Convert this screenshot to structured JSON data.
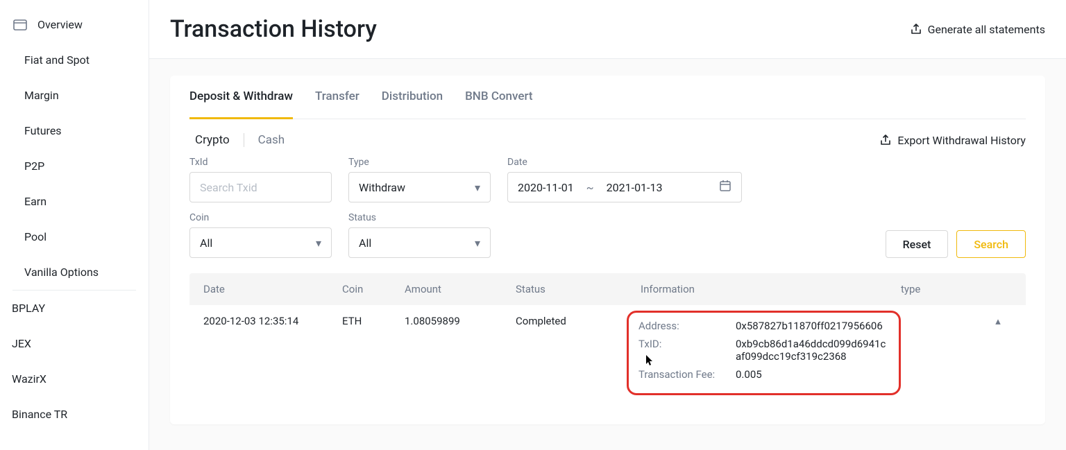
{
  "sidebar": {
    "overview": "Overview",
    "items": [
      "Fiat and Spot",
      "Margin",
      "Futures",
      "P2P",
      "Earn",
      "Pool",
      "Vanilla Options"
    ],
    "items2": [
      "BPLAY",
      "JEX",
      "WazirX",
      "Binance TR"
    ]
  },
  "header": {
    "title": "Transaction History",
    "generate": "Generate all statements"
  },
  "tabs": [
    "Deposit & Withdraw",
    "Transfer",
    "Distribution",
    "BNB Convert"
  ],
  "subtabs": {
    "crypto": "Crypto",
    "cash": "Cash",
    "export": "Export Withdrawal History"
  },
  "filters": {
    "txid_label": "TxId",
    "txid_placeholder": "Search Txid",
    "type_label": "Type",
    "type_value": "Withdraw",
    "date_label": "Date",
    "date_from": "2020-11-01",
    "date_to": "2021-01-13",
    "coin_label": "Coin",
    "coin_value": "All",
    "status_label": "Status",
    "status_value": "All",
    "reset": "Reset",
    "search": "Search"
  },
  "table": {
    "headers": {
      "date": "Date",
      "coin": "Coin",
      "amount": "Amount",
      "status": "Status",
      "info": "Information",
      "type": "type"
    },
    "row": {
      "date": "2020-12-03 12:35:14",
      "coin": "ETH",
      "amount": "1.08059899",
      "status": "Completed",
      "info": {
        "address_label": "Address:",
        "address_value": "0x587827b11870ff0217956606",
        "txid_label": "TxID:",
        "txid_value": "0xb9cb86d1a46ddcd099d6941caf099dcc19cf319c2368",
        "fee_label": "Transaction Fee:",
        "fee_value": "0.005"
      }
    }
  }
}
